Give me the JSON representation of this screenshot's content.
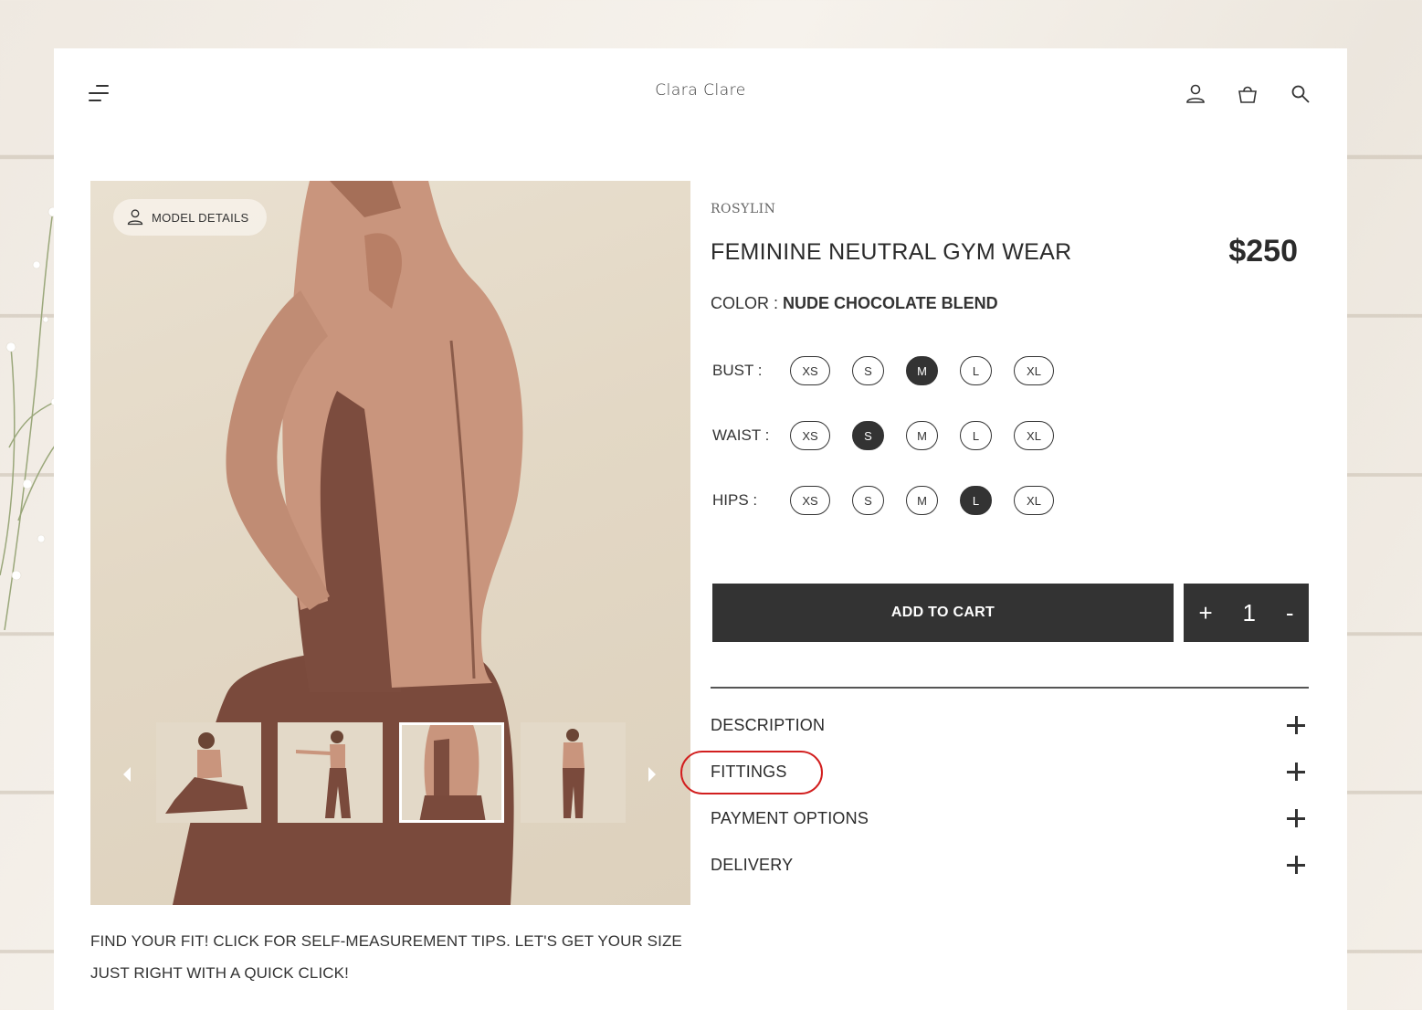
{
  "header": {
    "logo": "Clara Clare",
    "icons": [
      "menu-icon",
      "user-icon",
      "bag-icon",
      "search-icon"
    ]
  },
  "gallery": {
    "model_details_label": "MODEL DETAILS",
    "thumbnails": [
      {
        "label": "thumbnail-1",
        "active": false
      },
      {
        "label": "thumbnail-2",
        "active": false
      },
      {
        "label": "thumbnail-3",
        "active": true
      },
      {
        "label": "thumbnail-4",
        "active": false
      }
    ]
  },
  "product": {
    "brand": "ROSYLIN",
    "title": "FEMININE NEUTRAL GYM WEAR",
    "price": "$250",
    "color_label": "COLOR : ",
    "color_value": "NUDE CHOCOLATE BLEND"
  },
  "sizes": {
    "bust": {
      "label": "BUST  :",
      "options": [
        "XS",
        "S",
        "M",
        "L",
        "XL"
      ],
      "selected": "M"
    },
    "waist": {
      "label": "WAIST  :",
      "options": [
        "XS",
        "S",
        "M",
        "L",
        "XL"
      ],
      "selected": "S"
    },
    "hips": {
      "label": "HIPS  :",
      "options": [
        "XS",
        "S",
        "M",
        "L",
        "XL"
      ],
      "selected": "L"
    }
  },
  "cart": {
    "add_label": "ADD TO CART",
    "plus": "+",
    "quantity": "1",
    "minus": "-"
  },
  "accordion": [
    {
      "label": "DESCRIPTION"
    },
    {
      "label": "FITTINGS"
    },
    {
      "label": "PAYMENT OPTIONS"
    },
    {
      "label": "DELIVERY"
    }
  ],
  "fit_note": "FIND YOUR FIT! CLICK FOR SELF-MEASUREMENT TIPS. LET'S GET YOUR SIZE JUST RIGHT WITH A QUICK CLICK!",
  "colors": {
    "dark": "#333333",
    "highlight": "#d21f1f",
    "garment_light": "#c9957d",
    "garment_dark": "#7a4a3c"
  }
}
